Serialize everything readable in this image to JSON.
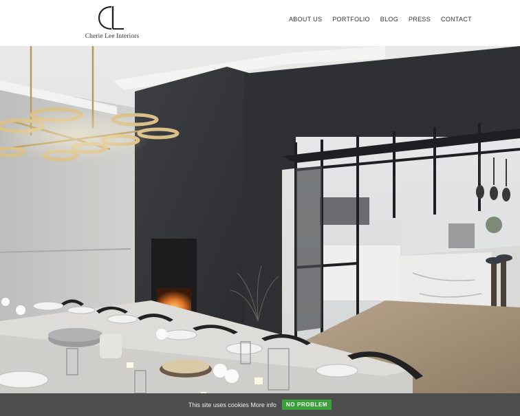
{
  "brand": {
    "monogram": "CL",
    "name": "Cherie Lee Interiors"
  },
  "nav": {
    "items": [
      {
        "label": "ABOUT US"
      },
      {
        "label": "PORTFOLIO"
      },
      {
        "label": "BLOG"
      },
      {
        "label": "PRESS"
      },
      {
        "label": "CONTACT"
      }
    ]
  },
  "hero": {
    "image_subject": "dining-room-and-kitchen-photo"
  },
  "cookie": {
    "message": "This site uses cookies",
    "more_info": "More info",
    "accept_label": "NO PROBLEM"
  },
  "colors": {
    "cookie_bar": "#464646",
    "accept_button": "#3aa13a",
    "text": "#333333"
  }
}
